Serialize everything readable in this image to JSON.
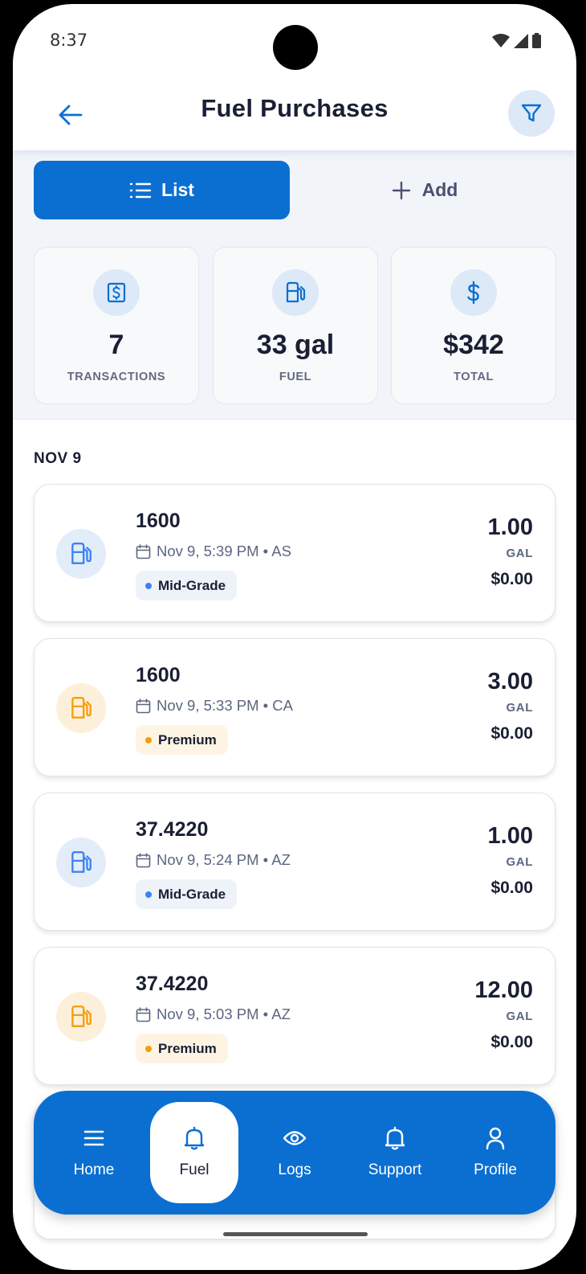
{
  "status_bar": {
    "time": "8:37"
  },
  "header": {
    "title": "Fuel Purchases"
  },
  "tabs": [
    {
      "label": "List",
      "active": true
    },
    {
      "label": "Add",
      "active": false
    }
  ],
  "summary": [
    {
      "value": "7",
      "label": "TRANSACTIONS",
      "icon": "receipt-icon"
    },
    {
      "value": "33 gal",
      "label": "FUEL",
      "icon": "fuel-pump-icon"
    },
    {
      "value": "$342",
      "label": "TOTAL",
      "icon": "dollar-icon"
    }
  ],
  "section": {
    "date_label": "NOV 9"
  },
  "transactions": [
    {
      "location": "1600",
      "meta": "Nov 9, 5:39 PM • AS",
      "grade": "Mid-Grade",
      "gallons": "1.00",
      "unit": "GAL",
      "price": "$0.00"
    },
    {
      "location": "1600",
      "meta": "Nov 9, 5:33 PM • CA",
      "grade": "Premium",
      "gallons": "3.00",
      "unit": "GAL",
      "price": "$0.00"
    },
    {
      "location": "37.4220",
      "meta": "Nov 9, 5:24 PM • AZ",
      "grade": "Mid-Grade",
      "gallons": "1.00",
      "unit": "GAL",
      "price": "$0.00"
    },
    {
      "location": "37.4220",
      "meta": "Nov 9, 5:03 PM • AZ",
      "grade": "Premium",
      "gallons": "12.00",
      "unit": "GAL",
      "price": "$0.00"
    }
  ],
  "nav": [
    {
      "label": "Home",
      "icon": "menu-icon"
    },
    {
      "label": "Fuel",
      "icon": "bell-icon",
      "active": true
    },
    {
      "label": "Logs",
      "icon": "eye-icon"
    },
    {
      "label": "Support",
      "icon": "bell-icon"
    },
    {
      "label": "Profile",
      "icon": "user-icon"
    }
  ],
  "colors": {
    "primary": "#0b6fd1",
    "mid_grade_accent": "#3b82f6",
    "premium_accent": "#f59e0b",
    "text_dark": "#1a1f33",
    "text_muted": "#5b6680"
  }
}
